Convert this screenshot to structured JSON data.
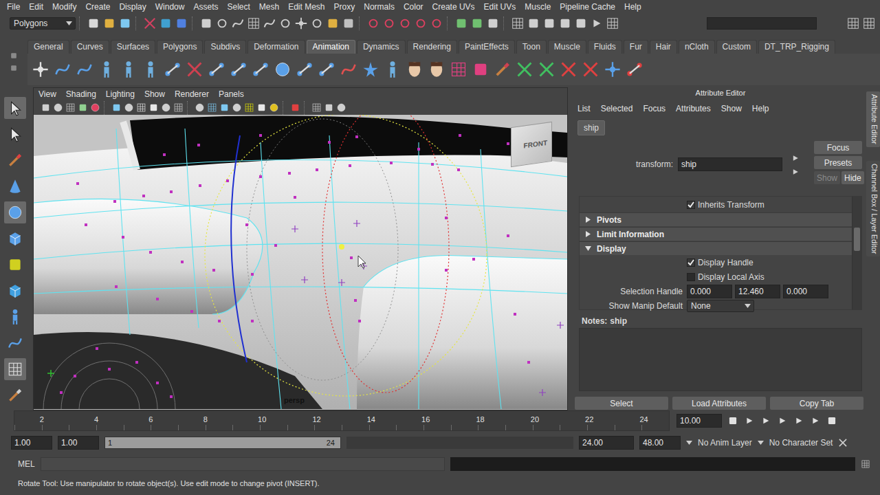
{
  "menu_bar": [
    "File",
    "Edit",
    "Modify",
    "Create",
    "Display",
    "Window",
    "Assets",
    "Select",
    "Mesh",
    "Edit Mesh",
    "Proxy",
    "Normals",
    "Color",
    "Create UVs",
    "Edit UVs",
    "Muscle",
    "Pipeline Cache",
    "Help"
  ],
  "status_line": {
    "menu_set": "Polygons"
  },
  "shelf": {
    "tabs": [
      {
        "label": "General",
        "selected": false
      },
      {
        "label": "Curves",
        "selected": false
      },
      {
        "label": "Surfaces",
        "selected": false
      },
      {
        "label": "Polygons",
        "selected": false
      },
      {
        "label": "Subdivs",
        "selected": false
      },
      {
        "label": "Deformation",
        "selected": false
      },
      {
        "label": "Animation",
        "selected": true
      },
      {
        "label": "Dynamics",
        "selected": false
      },
      {
        "label": "Rendering",
        "selected": false
      },
      {
        "label": "PaintEffects",
        "selected": false
      },
      {
        "label": "Toon",
        "selected": false
      },
      {
        "label": "Muscle",
        "selected": false
      },
      {
        "label": "Fluids",
        "selected": false
      },
      {
        "label": "Fur",
        "selected": false
      },
      {
        "label": "Hair",
        "selected": false
      },
      {
        "label": "nCloth",
        "selected": false
      },
      {
        "label": "Custom",
        "selected": false
      },
      {
        "label": "DT_TRP_Rigging",
        "selected": false
      }
    ]
  },
  "viewport": {
    "menu": [
      "View",
      "Shading",
      "Lighting",
      "Show",
      "Renderer",
      "Panels"
    ],
    "camera": "persp",
    "view_cube": "FRONT"
  },
  "attribute_editor": {
    "title": "Attribute Editor",
    "menu": [
      "List",
      "Selected",
      "Focus",
      "Attributes",
      "Show",
      "Help"
    ],
    "tabs": [
      {
        "label": "ship",
        "selected": true
      }
    ],
    "transform_label": "transform:",
    "transform_value": "ship",
    "side_buttons": [
      {
        "label": "Focus",
        "disabled": false
      },
      {
        "label": "Presets",
        "disabled": false
      },
      {
        "label": "Show",
        "disabled": true
      },
      {
        "label": "Hide",
        "disabled": false
      }
    ],
    "scroll": {
      "level": 0.35
    },
    "rows": [
      {
        "kind": "checkbox",
        "label": "Inherits Transform",
        "checked": true
      },
      {
        "kind": "section",
        "label": "Pivots",
        "expanded": false
      },
      {
        "kind": "section",
        "label": "Limit Information",
        "expanded": false
      },
      {
        "kind": "section",
        "label": "Display",
        "expanded": true
      },
      {
        "kind": "checkbox",
        "label": "Display Handle",
        "checked": true
      },
      {
        "kind": "checkbox",
        "label": "Display Local Axis",
        "checked": false
      },
      {
        "kind": "vector",
        "label": "Selection Handle",
        "values": [
          "0.000",
          "12.460",
          "0.000"
        ]
      },
      {
        "kind": "dropdown",
        "label": "Show Manip Default",
        "value": "None"
      }
    ],
    "notes_label": "Notes:",
    "notes_object": "ship",
    "bottom_buttons": [
      "Select",
      "Load Attributes",
      "Copy Tab"
    ]
  },
  "side_tabs": [
    {
      "label": "Attribute Editor",
      "selected": true
    },
    {
      "label": "Channel Box / Layer Editor",
      "selected": false
    }
  ],
  "time_slider": {
    "ticks": [
      "2",
      "4",
      "6",
      "8",
      "10",
      "12",
      "14",
      "16",
      "18",
      "20",
      "22",
      "24"
    ],
    "current_frame": "10.00"
  },
  "range_slider": {
    "start_time": "1.00",
    "playback_start": "1.00",
    "range_start": "1",
    "range_end": "24",
    "playback_end": "24.00",
    "end_time": "48.00",
    "anim_layer": "No Anim Layer",
    "character_set": "No Character Set"
  },
  "command_line": {
    "language": "MEL"
  },
  "help_line": "Rotate Tool: Use manipulator to rotate object(s). Use edit mode to change pivot (INSERT)."
}
